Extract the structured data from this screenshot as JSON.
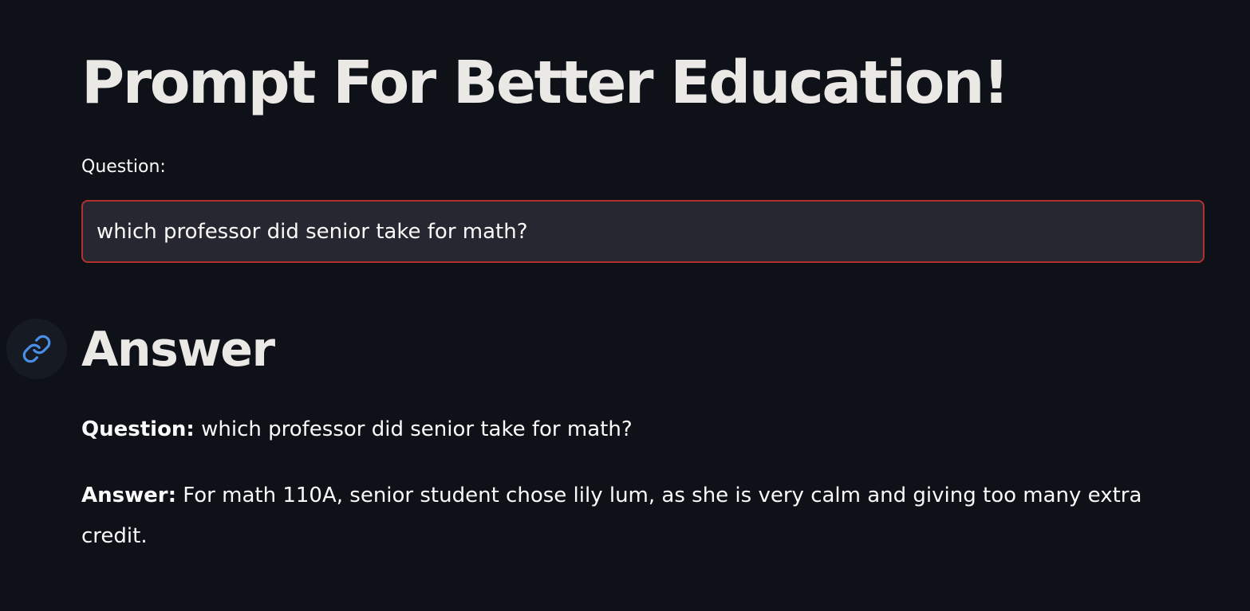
{
  "page": {
    "title": "Prompt For Better Education!"
  },
  "question_input": {
    "label": "Question:",
    "value": "which professor did senior take for math?"
  },
  "answer_section": {
    "heading": "Answer",
    "anchor_icon": "link-icon",
    "question_label": "Question:",
    "question_text": "which professor did senior take for math?",
    "answer_label": "Answer:",
    "answer_text": "For math 110A, senior student chose lily lum, as she is very calm and giving too many extra credit."
  },
  "colors": {
    "background": "#0e1117",
    "input_border": "#b0312e",
    "input_background": "#262730",
    "link_icon": "#4a8fe8"
  }
}
